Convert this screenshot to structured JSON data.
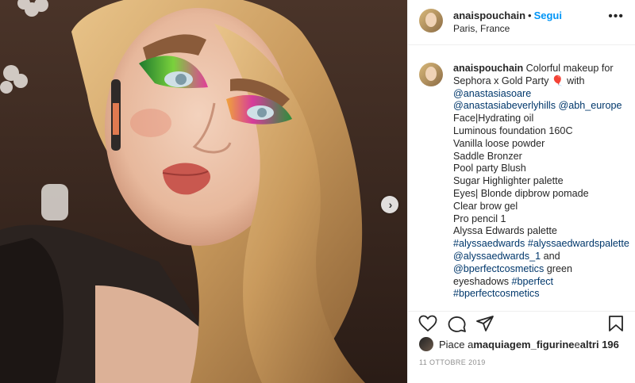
{
  "header": {
    "username": "anaispouchain",
    "separator": "•",
    "follow_label": "Segui",
    "location": "Paris, France",
    "more_icon": "more-options-icon"
  },
  "caption": {
    "username": "anaispouchain",
    "text_after_username": " Colorful makeup for",
    "line2_text": "Sephora x Gold Party",
    "line2_emoji": "🎈",
    "line2_after": " with",
    "mention1": "@anastasiasoare",
    "mention2": "@anastasiabeverlyhills",
    "mention3": "@abh_europe",
    "lines": [
      "Face|Hydrating oil",
      "Luminous foundation 160C",
      "Vanilla loose powder",
      "Saddle Bronzer",
      "Pool party Blush",
      "Sugar Highlighter palette",
      "Eyes| Blonde dipbrow pomade",
      "Clear brow gel",
      "Pro pencil 1",
      "Alyssa Edwards palette"
    ],
    "hashtag1": "#alyssaedwards",
    "hashtag2": "#alyssaedwardspalette",
    "mention4": "@alyssaedwards_1",
    "and_text": " and",
    "mention5": "@bperfectcosmetics",
    "green_text": " green",
    "eyeshadows_text": "eyeshadows ",
    "hashtag3": "#bperfect",
    "hashtag4": "#bperfectcosmetics"
  },
  "likes": {
    "prefix": "Piace a ",
    "user": "maquiagem_figurine",
    "middle": " e ",
    "others": "altri 196"
  },
  "date": "11 OTTOBRE 2019",
  "colors": {
    "follow": "#0095f6",
    "link": "#00376b",
    "text": "#262626",
    "muted": "#8e8e8e"
  }
}
